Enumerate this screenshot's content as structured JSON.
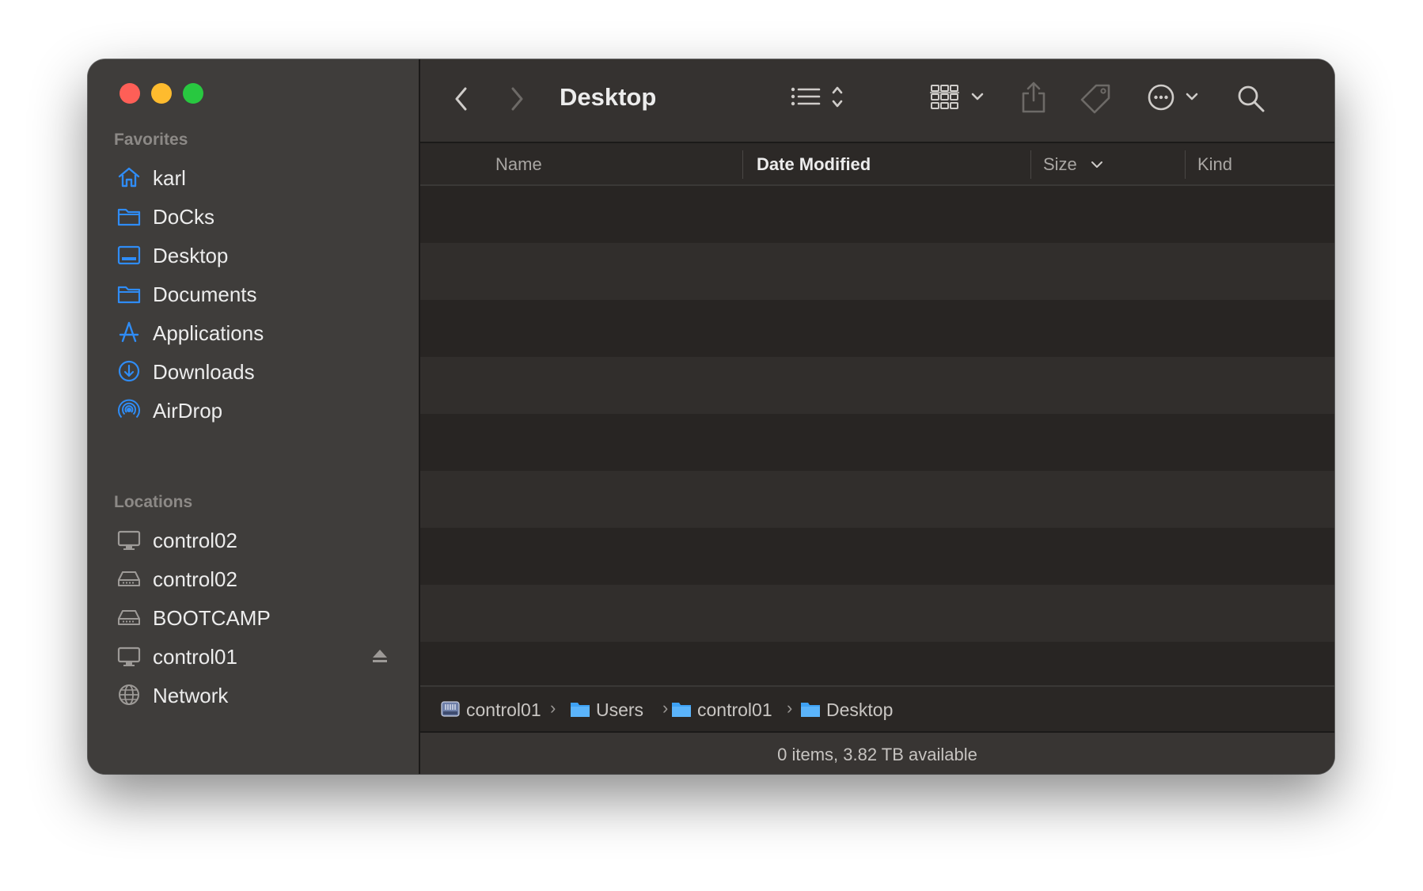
{
  "window": {
    "title": "Desktop"
  },
  "sidebar": {
    "favorites_title": "Favorites",
    "favorites": [
      {
        "label": "karl",
        "icon": "home-icon"
      },
      {
        "label": "DoCks",
        "icon": "folder-icon"
      },
      {
        "label": "Desktop",
        "icon": "desktop-folder-icon"
      },
      {
        "label": "Documents",
        "icon": "folder-icon"
      },
      {
        "label": "Applications",
        "icon": "applications-icon"
      },
      {
        "label": "Downloads",
        "icon": "download-icon"
      },
      {
        "label": "AirDrop",
        "icon": "airdrop-icon"
      }
    ],
    "locations_title": "Locations",
    "locations": [
      {
        "label": "control02",
        "icon": "computer-icon"
      },
      {
        "label": "control02",
        "icon": "drive-icon"
      },
      {
        "label": "BOOTCAMP",
        "icon": "drive-icon"
      },
      {
        "label": "control01",
        "icon": "computer-icon",
        "eject": true
      },
      {
        "label": "Network",
        "icon": "globe-icon"
      }
    ],
    "accent_color": "#2f8cf5"
  },
  "columns": {
    "name": "Name",
    "date_modified": "Date Modified",
    "size": "Size",
    "kind": "Kind",
    "sorted_by": "Date Modified"
  },
  "path": [
    {
      "label": "control01",
      "icon": "hard-disk-icon"
    },
    {
      "label": "Users",
      "icon": "folder-icon"
    },
    {
      "label": "control01",
      "icon": "folder-icon"
    },
    {
      "label": "Desktop",
      "icon": "folder-icon"
    }
  ],
  "status": {
    "text": "0 items, 3.82 TB available"
  }
}
